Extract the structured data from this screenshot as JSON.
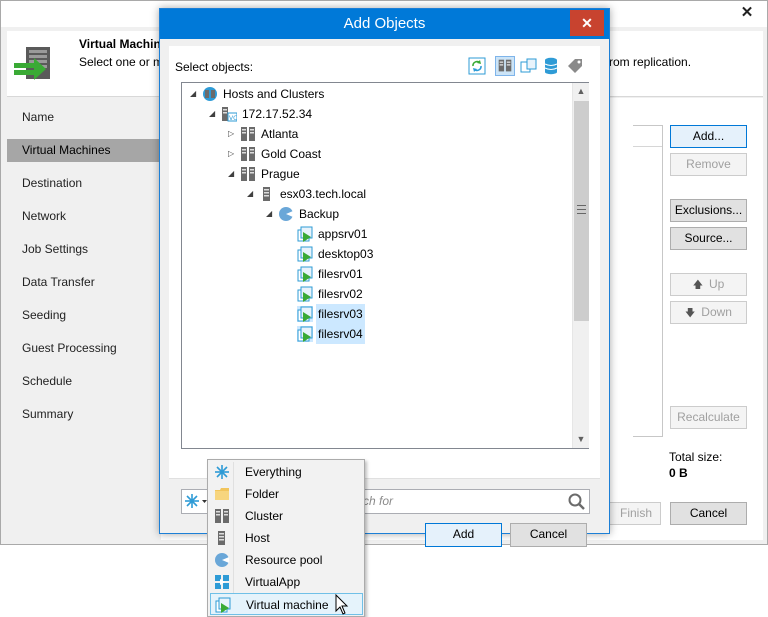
{
  "wizard": {
    "close_glyph": "✕",
    "header": {
      "title": "Virtual Machines",
      "description": "Select one or more VMs to process. Use Exclusions to exclude objects from replication.",
      "description_visible_left": "Select one or m",
      "description_visible_right": "rom replication."
    },
    "steps": [
      {
        "label": "Name",
        "active": false
      },
      {
        "label": "Virtual Machines",
        "active": true
      },
      {
        "label": "Destination",
        "active": false
      },
      {
        "label": "Network",
        "active": false
      },
      {
        "label": "Job Settings",
        "active": false
      },
      {
        "label": "Data Transfer",
        "active": false
      },
      {
        "label": "Seeding",
        "active": false
      },
      {
        "label": "Guest Processing",
        "active": false
      },
      {
        "label": "Schedule",
        "active": false
      },
      {
        "label": "Summary",
        "active": false
      }
    ],
    "buttons": {
      "add": "Add...",
      "remove": "Remove",
      "exclusions": "Exclusions...",
      "source": "Source...",
      "up": "Up",
      "down": "Down",
      "recalculate": "Recalculate",
      "finish": "Finish",
      "cancel": "Cancel"
    },
    "total_size_label": "Total size:",
    "total_size_value": "0 B"
  },
  "dialog": {
    "title": "Add Objects",
    "close_glyph": "✕",
    "select_label": "Select objects:",
    "tree": [
      {
        "label": "Hosts and Clusters",
        "icon": "hosts-clusters-icon",
        "toggle": "expanded",
        "selected": false
      },
      {
        "label": "172.17.52.34",
        "icon": "vcenter-icon",
        "toggle": "expanded",
        "selected": false
      },
      {
        "label": "Atlanta",
        "icon": "cluster-icon",
        "toggle": "collapsed",
        "selected": false
      },
      {
        "label": "Gold Coast",
        "icon": "cluster-icon",
        "toggle": "collapsed",
        "selected": false
      },
      {
        "label": "Prague",
        "icon": "cluster-icon",
        "toggle": "expanded",
        "selected": false
      },
      {
        "label": "esx03.tech.local",
        "icon": "host-icon",
        "toggle": "expanded",
        "selected": false
      },
      {
        "label": "Backup",
        "icon": "resource-pool-icon",
        "toggle": "expanded",
        "selected": false
      },
      {
        "label": "appsrv01",
        "icon": "vm-icon",
        "toggle": "none",
        "selected": false
      },
      {
        "label": "desktop03",
        "icon": "vm-icon",
        "toggle": "none",
        "selected": false
      },
      {
        "label": "filesrv01",
        "icon": "vm-icon",
        "toggle": "none",
        "selected": false
      },
      {
        "label": "filesrv02",
        "icon": "vm-icon",
        "toggle": "none",
        "selected": false
      },
      {
        "label": "filesrv03",
        "icon": "vm-icon",
        "toggle": "none",
        "selected": true
      },
      {
        "label": "filesrv04",
        "icon": "vm-icon",
        "toggle": "none",
        "selected": true
      }
    ],
    "search_placeholder": "rch for",
    "buttons": {
      "add": "Add",
      "cancel": "Cancel"
    }
  },
  "dropdown": {
    "items": [
      {
        "label": "Everything",
        "icon": "everything-icon",
        "highlighted": false
      },
      {
        "label": "Folder",
        "icon": "folder-icon",
        "highlighted": false
      },
      {
        "label": "Cluster",
        "icon": "cluster-icon",
        "highlighted": false
      },
      {
        "label": "Host",
        "icon": "host-icon",
        "highlighted": false
      },
      {
        "label": "Resource pool",
        "icon": "resource-pool-icon",
        "highlighted": false
      },
      {
        "label": "VirtualApp",
        "icon": "vapp-icon",
        "highlighted": false
      },
      {
        "label": "Virtual machine",
        "icon": "vm-icon",
        "highlighted": true
      }
    ]
  },
  "colors": {
    "dialog_titlebar": "#0079d8",
    "close_button": "#c8432f",
    "selection": "#cce8ff",
    "active_step": "#a6a6a6",
    "vm_icon_green": "#3aaa35"
  }
}
